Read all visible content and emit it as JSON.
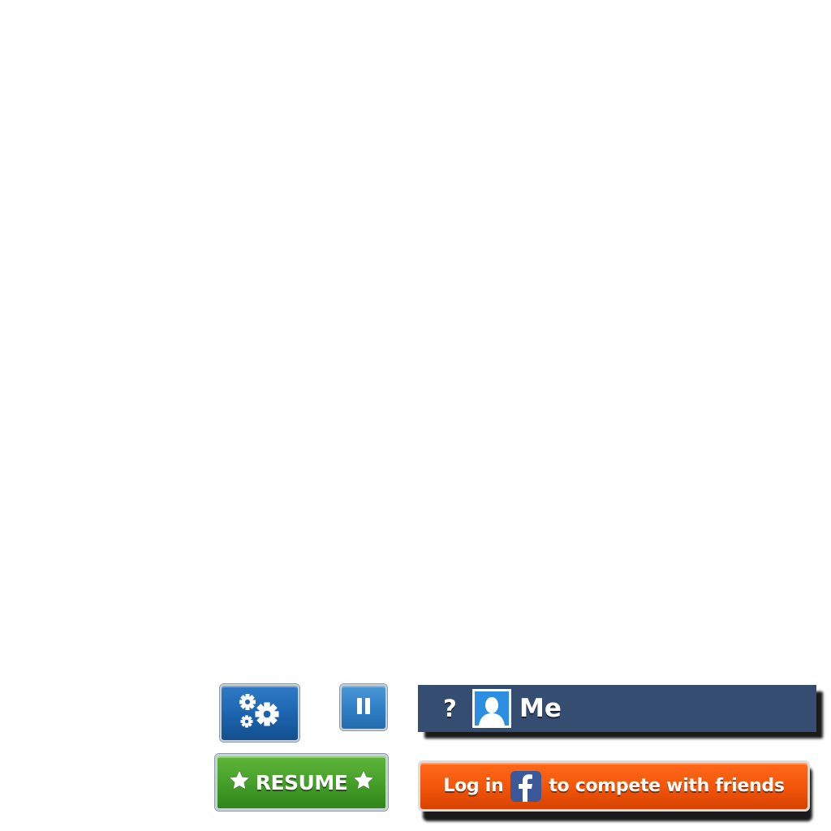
{
  "controls": {
    "settings_icon": "gears-icon",
    "pause_icon": "pause-icon"
  },
  "resume": {
    "label": "RESUME",
    "icon": "star-icon",
    "color": "#46a029"
  },
  "player": {
    "rank": "?",
    "name": "Me",
    "avatar_icon": "default-avatar-icon",
    "bar_color": "#344d70"
  },
  "facebook_login": {
    "prefix": "Log in",
    "suffix": "to compete with friends",
    "icon": "facebook-icon",
    "color": "#f4560a",
    "brand_color": "#3b5998"
  }
}
